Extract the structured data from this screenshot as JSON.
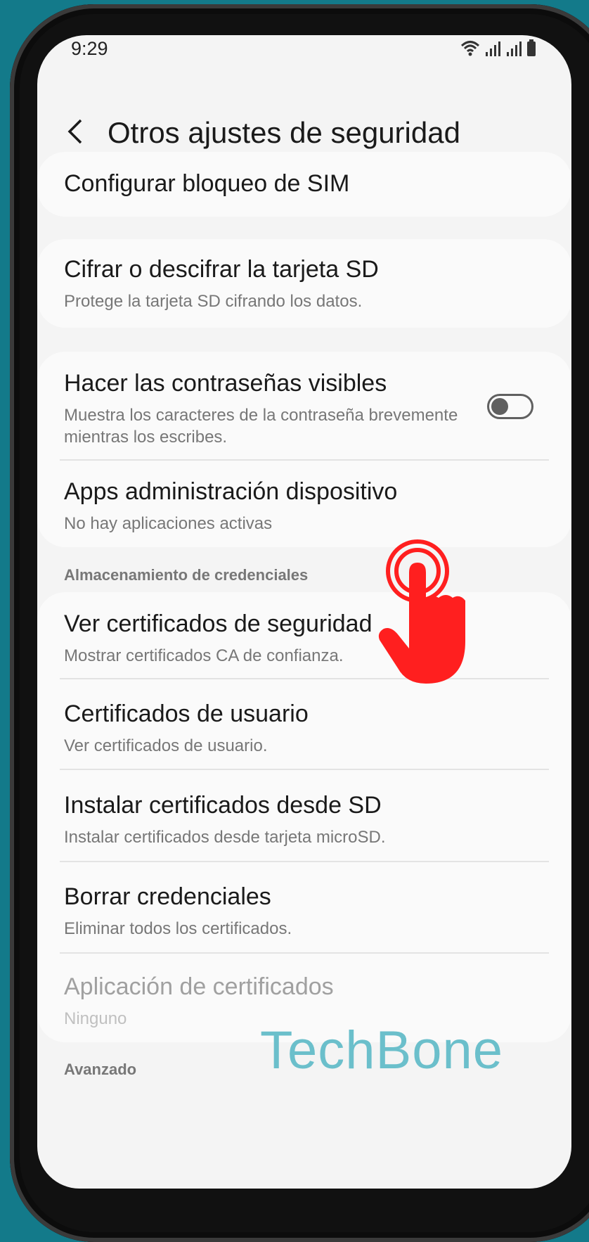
{
  "status_bar": {
    "time": "9:29",
    "icons": [
      "wifi-icon",
      "signal-icon",
      "signal-icon",
      "battery-icon"
    ]
  },
  "header": {
    "title": "Otros ajustes de seguridad",
    "back_icon": "chevron-left-icon"
  },
  "items": [
    {
      "title": "Configurar bloqueo de SIM"
    },
    {
      "title": "Cifrar o descifrar la tarjeta SD",
      "subtitle": "Protege la tarjeta SD cifrando los datos."
    },
    {
      "title": "Hacer las contraseñas visibles",
      "subtitle": "Muestra los caracteres de la contraseña brevemente mientras los escribes.",
      "toggle": "off"
    },
    {
      "title": "Apps administración dispositivo",
      "subtitle": "No hay aplicaciones activas"
    }
  ],
  "credentials": {
    "section_label": "Almacenamiento de credenciales",
    "items": [
      {
        "title": "Ver certificados de seguridad",
        "subtitle": "Mostrar certificados CA de confianza."
      },
      {
        "title": "Certificados de usuario",
        "subtitle": "Ver certificados de usuario."
      },
      {
        "title": "Instalar certificados desde SD",
        "subtitle": "Instalar certificados desde tarjeta microSD."
      },
      {
        "title": "Borrar credenciales",
        "subtitle": "Eliminar todos los certificados."
      },
      {
        "title": "Aplicación de certificados",
        "subtitle": "Ninguno",
        "disabled": true
      }
    ]
  },
  "advanced": {
    "section_label": "Avanzado"
  },
  "watermark": "TechBone",
  "colors": {
    "background": "#137a8a",
    "hand": "#ff1f1f",
    "watermark": "#6bbfcb"
  }
}
